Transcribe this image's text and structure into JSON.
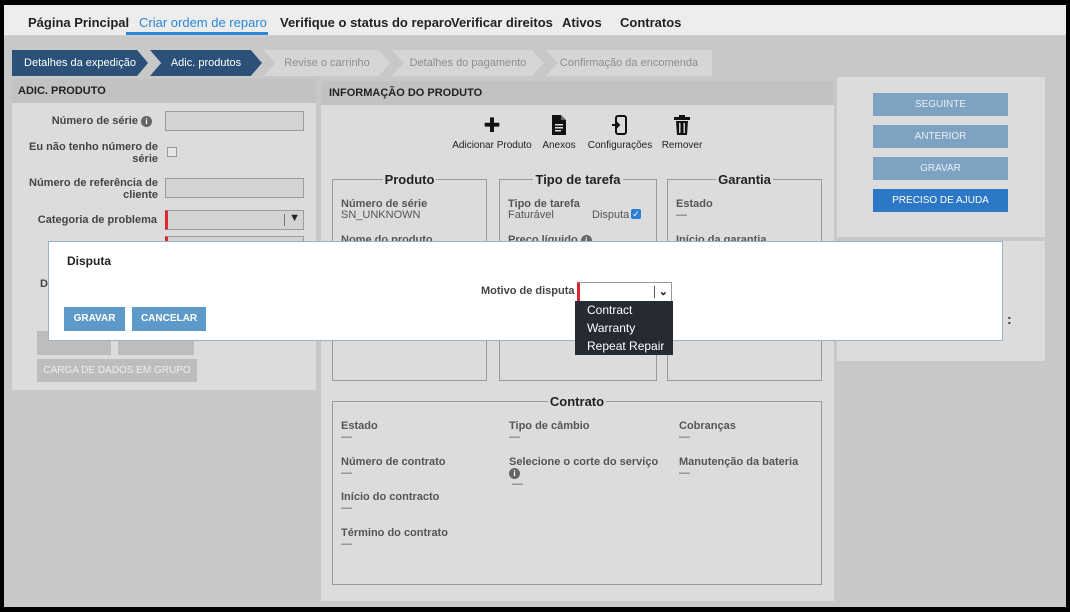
{
  "nav": {
    "items": [
      "Página Principal",
      "Criar ordem de reparo",
      "Verifique o status do reparo",
      "Verificar direitos",
      "Ativos",
      "Contratos"
    ],
    "active_index": 1
  },
  "steps": [
    "Detalhes da expedição",
    "Adic. produtos",
    "Revise o carrinho",
    "Detalhes do pagamento",
    "Confirmação da encomenda"
  ],
  "left_panel": {
    "title": "ADIC. PRODUTO",
    "serial_label": "Número de série",
    "no_serial_label": "Eu não tenho número de série",
    "ref_label": "Número de referência de cliente",
    "problem_label": "Categoria de problema",
    "partial_label": "D",
    "bulk_button": "CARGA DE DADOS EM GRUPO"
  },
  "center": {
    "title": "INFORMAÇÃO DO PRODUTO",
    "tools": [
      {
        "label": "Adicionar Produto",
        "icon": "plus-icon"
      },
      {
        "label": "Anexos",
        "icon": "document-icon"
      },
      {
        "label": "Configurações",
        "icon": "device-config-icon"
      },
      {
        "label": "Remover",
        "icon": "trash-icon"
      }
    ],
    "produto": {
      "title": "Produto",
      "serial_label": "Número de série",
      "serial_value": "SN_UNKNOWN",
      "name_label": "Nome do produto"
    },
    "tarefa": {
      "title": "Tipo de tarefa",
      "type_label": "Tipo de tarefa",
      "type_value": "Faturável",
      "dispute_label": "Disputa",
      "dispute_checked": true,
      "net_price_label": "Preço líquido"
    },
    "garantia": {
      "title": "Garantia",
      "state_label": "Estado",
      "state_value": "—",
      "start_label": "Início da garantia"
    },
    "contrato": {
      "title": "Contrato",
      "state_label": "Estado",
      "state_value": "—",
      "exchange_label": "Tipo de câmbio",
      "exchange_value": "—",
      "charges_label": "Cobranças",
      "charges_value": "—",
      "number_label": "Número de contrato",
      "number_value": "—",
      "service_cut_label": "Selecione o corte do serviço",
      "service_cut_value": "—",
      "battery_label": "Manutenção da bateria",
      "battery_value": "—",
      "start_label": "Início do contracto",
      "start_value": "—",
      "end_label": "Término do contrato",
      "end_value": "—"
    }
  },
  "right_panel": {
    "next": "SEGUINTE",
    "previous": "ANTERIOR",
    "save": "GRAVAR",
    "help": "PRECISO DE AJUDA",
    "partial_colon": ":"
  },
  "modal": {
    "title": "Disputa",
    "reason_label": "Motivo de disputa",
    "reason_value": "",
    "save": "GRAVAR",
    "cancel": "CANCELAR",
    "options": [
      "Contract",
      "Warranty",
      "Repeat Repair"
    ]
  },
  "colors": {
    "accent": "#2a87d6",
    "step_done": "#2b5178",
    "required": "#d9282f",
    "help_button": "#2d78c6"
  }
}
